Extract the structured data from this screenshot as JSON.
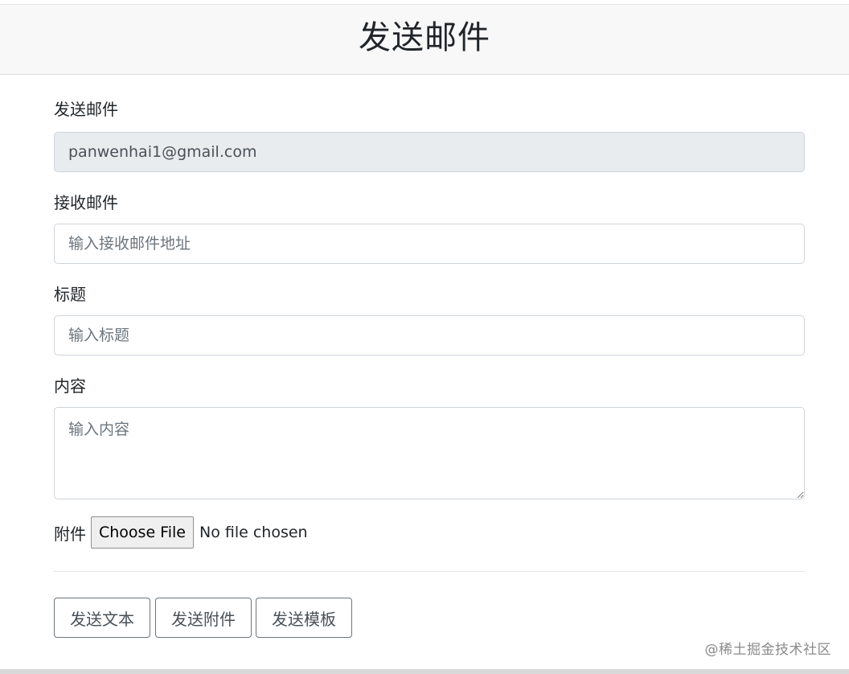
{
  "header": {
    "title": "发送邮件"
  },
  "form": {
    "sender": {
      "label": "发送邮件",
      "value": "panwenhai1@gmail.com"
    },
    "recipient": {
      "label": "接收邮件",
      "placeholder": "输入接收邮件地址"
    },
    "subject": {
      "label": "标题",
      "placeholder": "输入标题"
    },
    "content": {
      "label": "内容",
      "placeholder": "输入内容"
    },
    "attachment": {
      "label": "附件",
      "button_label": "Choose File",
      "status": "No file chosen"
    }
  },
  "actions": {
    "send_text": "发送文本",
    "send_attachment": "发送附件",
    "send_template": "发送模板"
  },
  "watermark": "@稀土掘金技术社区",
  "colors": {
    "header_bg": "#f8f8f8",
    "readonly_bg": "#e9ecef",
    "border": "#ced4da",
    "button_border": "#6c757d"
  }
}
